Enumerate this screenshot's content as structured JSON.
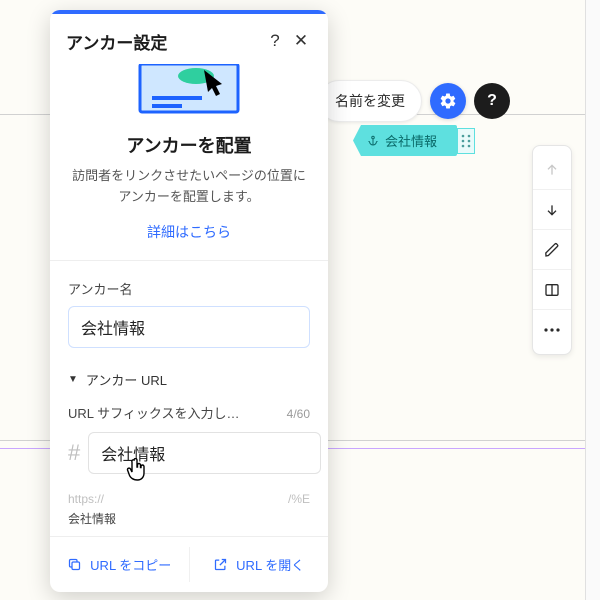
{
  "panel": {
    "title": "アンカー設定",
    "help_icon": "?",
    "close_icon": "✕",
    "placing_title": "アンカーを配置",
    "placing_desc": "訪問者をリンクさせたいページの位置にアンカーを配置します。",
    "learn_more": "詳細はこちら",
    "anchor_name_label": "アンカー名",
    "anchor_name_value": "会社情報",
    "url_section_label": "アンカー URL",
    "url_suffix_label": "URL サフィックスを入力し…",
    "char_count": "4/60",
    "hash": "#",
    "url_suffix_value": "会社情報",
    "url_preview_proto": "https://",
    "url_preview_path": "/%E",
    "url_preview_frag": "会社情報",
    "copy_url": "URL をコピー",
    "open_url": "URL を開く"
  },
  "top": {
    "rename": "名前を変更"
  },
  "anchor_chip": {
    "label": "会社情報"
  },
  "side": {
    "items": [
      {
        "name": "move-up",
        "disabled": true
      },
      {
        "name": "move-down",
        "disabled": false
      },
      {
        "name": "edit",
        "disabled": false
      },
      {
        "name": "layout",
        "disabled": false
      },
      {
        "name": "more",
        "disabled": false
      }
    ]
  }
}
